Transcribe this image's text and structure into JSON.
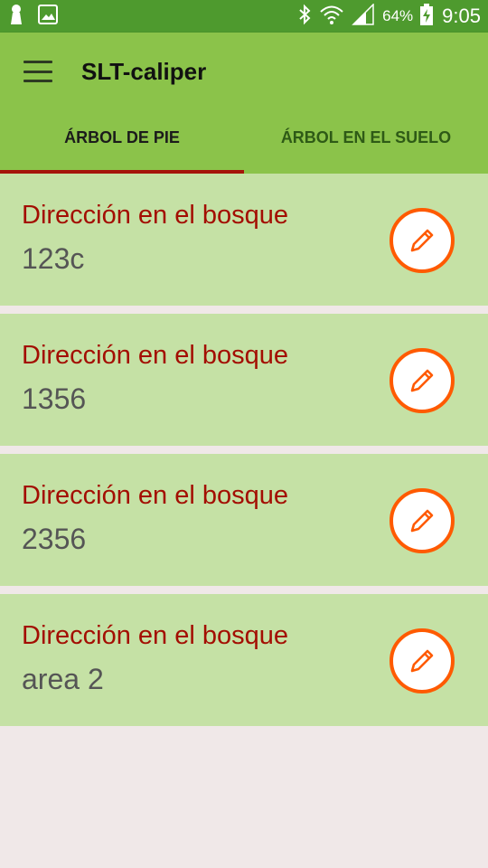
{
  "status_bar": {
    "battery": "64%",
    "time": "9:05",
    "icons": [
      "notification-icon",
      "image-icon",
      "bluetooth-icon",
      "wifi-icon",
      "signal-icon",
      "battery-charging-icon"
    ]
  },
  "app_bar": {
    "title": "SLT-caliper"
  },
  "tabs": [
    {
      "label": "ÁRBOL DE PIE",
      "active": true
    },
    {
      "label": "ÁRBOL EN EL SUELO",
      "active": false
    }
  ],
  "items": [
    {
      "title": "Dirección en el bosque",
      "value": "123c"
    },
    {
      "title": "Dirección en el bosque",
      "value": "1356"
    },
    {
      "title": "Dirección en el bosque",
      "value": "2356"
    },
    {
      "title": "Dirección en el bosque",
      "value": "area 2"
    }
  ],
  "colors": {
    "status_bar": "#4e9a2e",
    "app_bar": "#8bc34a",
    "card": "#c5e1a5",
    "title_text": "#a30e02",
    "edit_accent": "#ff5a00",
    "tab_indicator": "#a5150a",
    "background": "#f0e8e8"
  }
}
